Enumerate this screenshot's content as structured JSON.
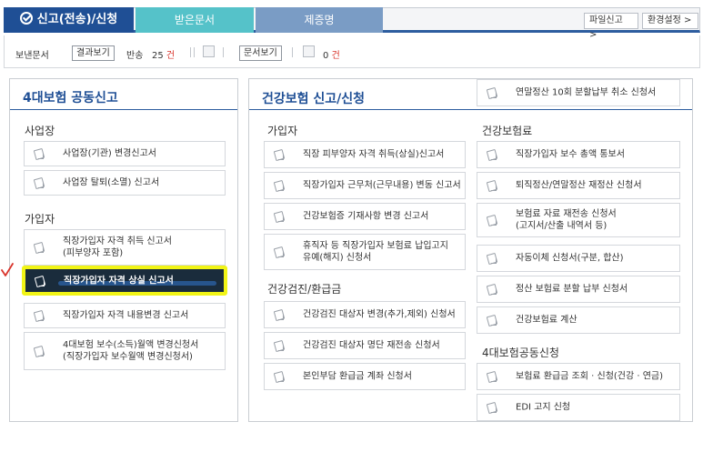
{
  "tabs": {
    "main": "신고(전송)/신청",
    "received": "받은문서",
    "certificate": "제증명",
    "file_report": "파일신고 >",
    "settings": "환경설정 >"
  },
  "status": {
    "sent_label": "보낸문서",
    "view_result": "결과보기",
    "return_label": "반송",
    "return_count": "25",
    "count_unit": "건",
    "view_doc": "문서보기",
    "doc_count": "0",
    "doc_unit": "건"
  },
  "left_panel": {
    "title": "4대보험 공동신고",
    "sections": [
      {
        "title": "사업장",
        "items": [
          "사업장(기관) 변경신고서",
          "사업장 탈퇴(소멸) 신고서"
        ]
      },
      {
        "title": "가입자",
        "items": [
          "직장가입자 자격 취득 신고서\n(피부양자 포함)",
          "직장가입자 자격 상실 신고서",
          "직장가입자 자격 내용변경 신고서",
          "4대보험 보수(소득)월액 변경신청서\n(직장가입자 보수월액 변경신청서)"
        ]
      }
    ]
  },
  "right_panel": {
    "title": "건강보험 신고/신청",
    "top_item": "연말정산 10회 분할납부 취소 신청서",
    "col1": [
      {
        "title": "가입자",
        "items": [
          "직장 피부양자 자격 취득(상실)신고서",
          "직장가입자 근무처(근무내용) 변동 신고서",
          "건강보험증 기재사항 변경 신고서",
          "휴직자 등 직장가입자 보험료 납입고지\n유예(해지) 신청서"
        ]
      },
      {
        "title": "건강검진/환급금",
        "items": [
          "건강검진 대상자 변경(추가,제외) 신청서",
          "건강검진 대상자 명단 재전송 신청서",
          "본인부담 환급금 계좌 신청서"
        ]
      }
    ],
    "col2": [
      {
        "title": "건강보험료",
        "items": [
          "직장가입자 보수 총액 통보서",
          "퇴직정산/연말정산 재정산 신청서",
          "보험료 자료 재전송 신청서\n(고지서/산출 내역서 등)",
          "자동이체 신청서(구분, 합산)",
          "정산 보험료 분할 납부 신청서",
          "건강보험료 계산"
        ]
      },
      {
        "title": "4대보험공동신청",
        "items": [
          "보험료 환급금 조회 · 신청(건강 · 연금)",
          "EDI 고지 신청"
        ]
      }
    ]
  },
  "colors": {
    "brand": "#1f4f95",
    "highlight": "#f1f416",
    "alert": "#d9342b"
  }
}
